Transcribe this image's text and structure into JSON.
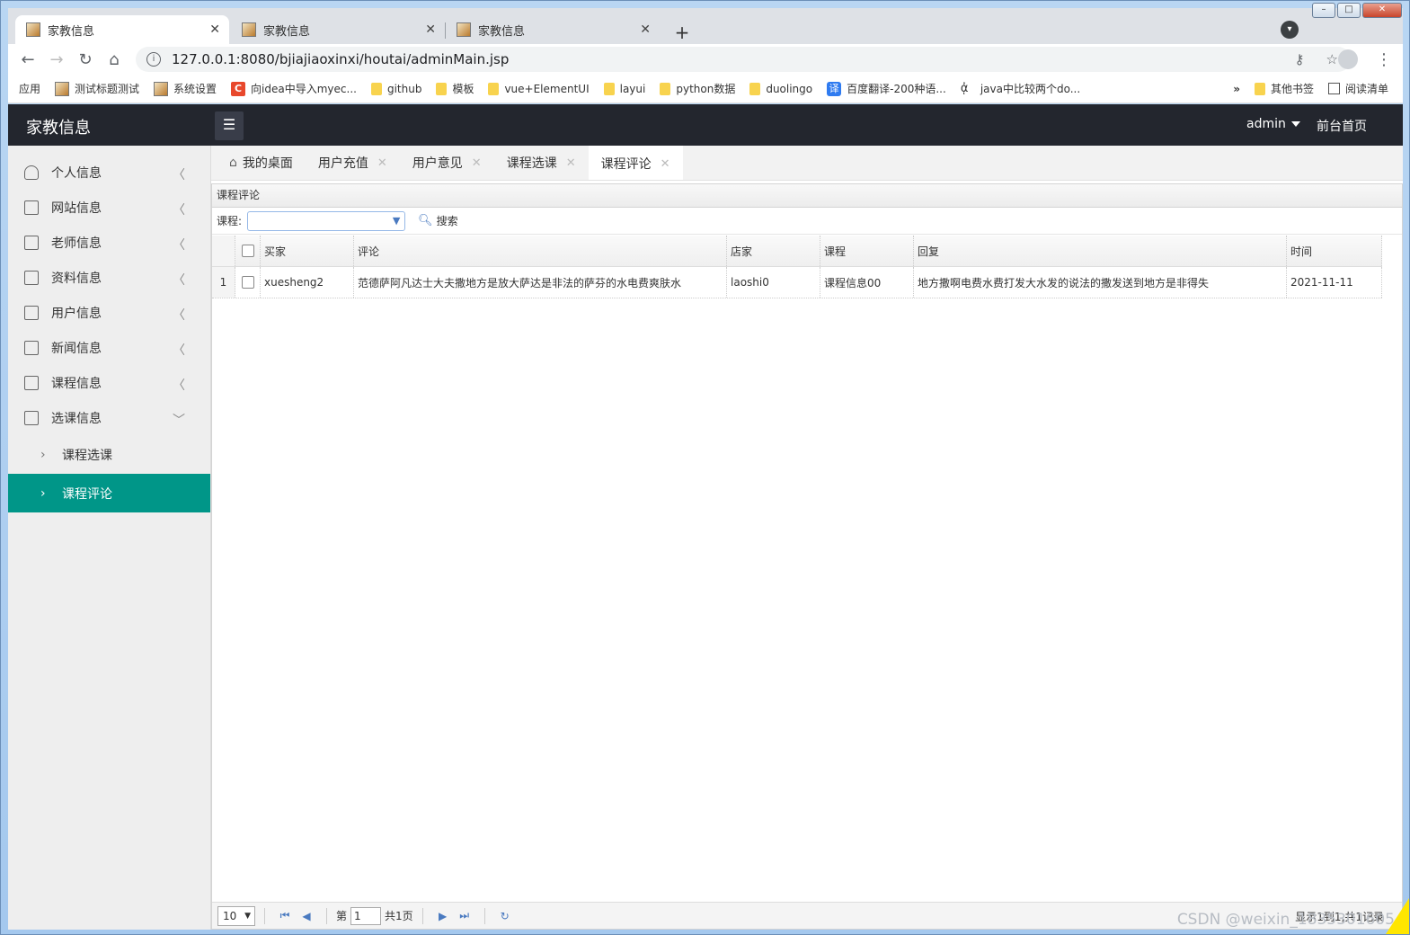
{
  "browser": {
    "tabs": [
      {
        "title": "家教信息",
        "active": true
      },
      {
        "title": "家教信息",
        "active": false
      },
      {
        "title": "家教信息",
        "active": false
      }
    ],
    "new_tab": "+",
    "url": "127.0.0.1:8080/bjiajiaoxinxi/houtai/adminMain.jsp",
    "bookmarks": [
      {
        "label": "应用",
        "icon": "grid"
      },
      {
        "label": "测试标题测试",
        "icon": "page"
      },
      {
        "label": "系统设置",
        "icon": "page"
      },
      {
        "label": "向idea中导入myec...",
        "icon": "red"
      },
      {
        "label": "github",
        "icon": "folder"
      },
      {
        "label": "模板",
        "icon": "folder"
      },
      {
        "label": "vue+ElementUI",
        "icon": "folder"
      },
      {
        "label": "layui",
        "icon": "folder"
      },
      {
        "label": "python数据",
        "icon": "folder"
      },
      {
        "label": "duolingo",
        "icon": "folder"
      },
      {
        "label": "百度翻译-200种语...",
        "icon": "blue"
      },
      {
        "label": "java中比较两个do...",
        "icon": "script"
      }
    ],
    "bookmarks_more": "»",
    "other_bookmarks": "其他书签",
    "reading_list": "阅读清单"
  },
  "app": {
    "logo": "家教信息",
    "user": "admin",
    "home_link": "前台首页"
  },
  "sidebar": {
    "items": [
      {
        "label": "个人信息",
        "icon": "user-icon"
      },
      {
        "label": "网站信息",
        "icon": "doc-icon"
      },
      {
        "label": "老师信息",
        "icon": "doc-icon"
      },
      {
        "label": "资料信息",
        "icon": "doc-icon"
      },
      {
        "label": "用户信息",
        "icon": "doc-icon"
      },
      {
        "label": "新闻信息",
        "icon": "doc-icon"
      },
      {
        "label": "课程信息",
        "icon": "doc-icon"
      },
      {
        "label": "选课信息",
        "icon": "doc-icon",
        "expanded": true
      }
    ],
    "subitems": [
      {
        "label": "课程选课",
        "active": false
      },
      {
        "label": "课程评论",
        "active": true
      }
    ]
  },
  "content_tabs": [
    {
      "label": "我的桌面",
      "closable": false
    },
    {
      "label": "用户充值",
      "closable": true
    },
    {
      "label": "用户意见",
      "closable": true
    },
    {
      "label": "课程选课",
      "closable": true
    },
    {
      "label": "课程评论",
      "closable": true,
      "active": true
    }
  ],
  "panel": {
    "title": "课程评论",
    "search_label": "课程:",
    "search_button": "搜索",
    "columns": [
      "买家",
      "评论",
      "店家",
      "课程",
      "回复",
      "时间"
    ],
    "rows": [
      {
        "num": "1",
        "buyer": "xuesheng2",
        "comment": "范德萨阿凡达士大夫撒地方是放大萨达是非法的萨芬的水电费爽肤水",
        "shop": "laoshi0",
        "course": "课程信息00",
        "reply": "地方撒啊电费水费打发大水发的说法的撒发送到地方是非得失",
        "time": "2021-11-11"
      }
    ]
  },
  "pager": {
    "page_size": "10",
    "page_label": "第",
    "page_value": "1",
    "total_pages": "共1页",
    "info": "显示1到1,共1记录"
  },
  "watermark": "CSDN @weixin_1835301605"
}
